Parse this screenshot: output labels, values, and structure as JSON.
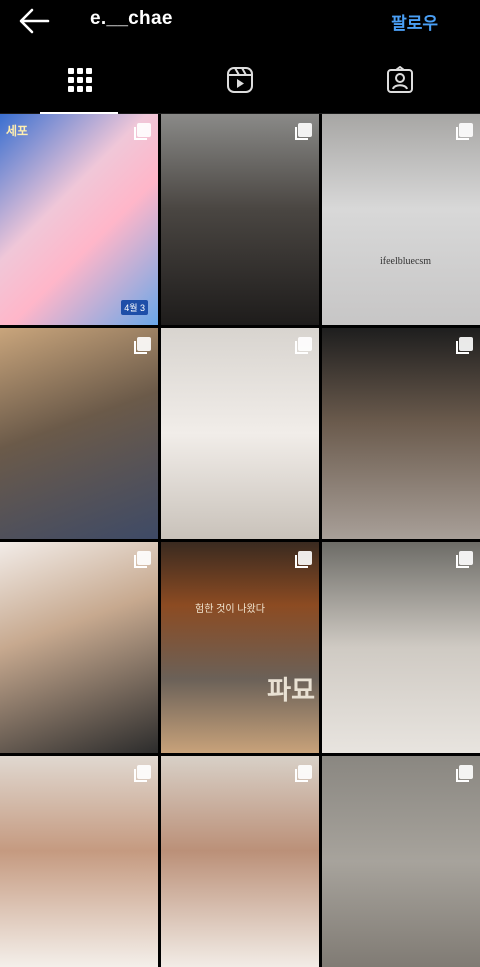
{
  "header": {
    "username": "e.__chae",
    "follow_label": "팔로우"
  },
  "tabs": [
    {
      "name": "grid",
      "icon": "grid-icon",
      "active": true
    },
    {
      "name": "reels",
      "icon": "reels-icon",
      "active": false
    },
    {
      "name": "tagged",
      "icon": "tagged-icon",
      "active": false
    }
  ],
  "colors": {
    "background": "#000000",
    "accent": "#4a9ff5",
    "text": "#ffffff"
  },
  "posts": [
    {
      "multi": true,
      "poster_text": "세포",
      "poster_date": "4월 3"
    },
    {
      "multi": true
    },
    {
      "multi": true,
      "shirt_text": "ifeelbluecsm"
    },
    {
      "multi": true
    },
    {
      "multi": true
    },
    {
      "multi": true
    },
    {
      "multi": true
    },
    {
      "multi": true,
      "movie_top": "험한 것이 나왔다",
      "movie_big": "파묘"
    },
    {
      "multi": true
    },
    {
      "multi": true
    },
    {
      "multi": true
    },
    {
      "multi": true
    }
  ]
}
